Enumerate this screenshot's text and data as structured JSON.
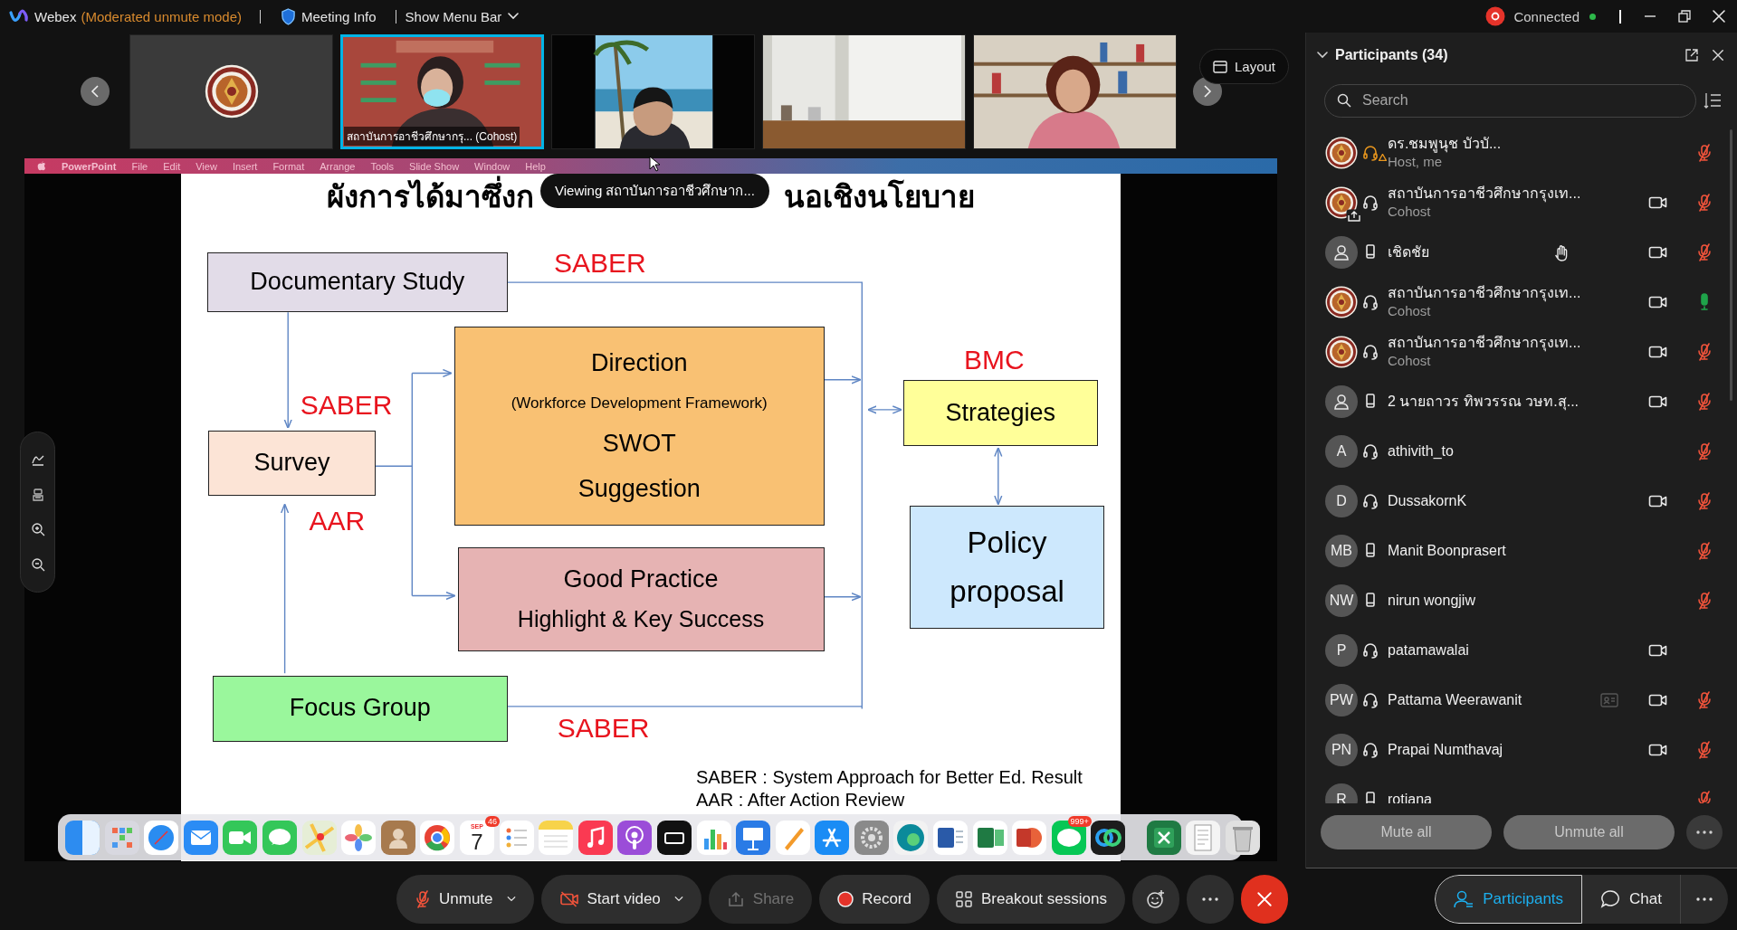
{
  "top_bar": {
    "app_name": "Webex",
    "mode": "(Moderated unmute mode)",
    "meeting_info": "Meeting Info",
    "menu_bar_toggle": "Show Menu Bar",
    "connection": "Connected"
  },
  "video_strip": {
    "tiles": [
      {
        "kind": "logo",
        "selected": false
      },
      {
        "kind": "picture",
        "label": "สถาบันการอาชีวศึกษากรุ... (Cohost)",
        "selected": true
      },
      {
        "kind": "picture",
        "selected": false
      },
      {
        "kind": "picture",
        "selected": false
      },
      {
        "kind": "picture",
        "selected": false
      }
    ],
    "layout_button": "Layout"
  },
  "shared_screen": {
    "menu_bar": [
      "PowerPoint",
      "File",
      "Edit",
      "View",
      "Insert",
      "Format",
      "Arrange",
      "Tools",
      "Slide Show",
      "Window",
      "Help"
    ],
    "viewing_tooltip": "Viewing สถาบันการอาชีวศึกษาก...",
    "slide": {
      "title_parts": [
        "ผังการได้มาซึ่งก",
        "นอเชิงนโยบาย"
      ],
      "boxes": [
        {
          "color": "#e2dce8",
          "lines": [
            {
              "text": "Documentary Study",
              "kind": "main"
            }
          ]
        },
        {
          "color": "#fce4d6",
          "lines": [
            {
              "text": "Survey",
              "kind": "main"
            }
          ]
        },
        {
          "color": "#f9c173",
          "lines": [
            {
              "text": "Direction",
              "kind": "main"
            },
            {
              "text": "(Workforce Development Framework)",
              "kind": "note"
            },
            {
              "text": "SWOT",
              "kind": "main"
            },
            {
              "text": "Suggestion",
              "kind": "main"
            }
          ]
        },
        {
          "color": "#e6b3b3",
          "lines": [
            {
              "text": "Good Practice",
              "kind": "main"
            },
            {
              "text": "Highlight & Key Success",
              "kind": "sub"
            }
          ]
        },
        {
          "color": "#9af79c",
          "lines": [
            {
              "text": "Focus Group",
              "kind": "main"
            }
          ]
        },
        {
          "color": "#ffff99",
          "lines": [
            {
              "text": "Strategies",
              "kind": "main"
            }
          ]
        },
        {
          "color": "#cde8fd",
          "lines": [
            {
              "text": "Policy",
              "kind": "big"
            },
            {
              "text": "proposal",
              "kind": "big"
            }
          ]
        }
      ],
      "labels": [
        "SABER",
        "SABER",
        "AAR",
        "BMC",
        "SABER"
      ],
      "legend": [
        "SABER : System Approach for Better Ed. Result",
        "AAR : After Action Review"
      ]
    }
  },
  "dock": {
    "calendar": {
      "month": "SEP",
      "day": "7",
      "badge": "46"
    },
    "messenger_badge": "999+"
  },
  "participants": {
    "title": "Participants (34)",
    "search_placeholder": "Search",
    "rows": [
      {
        "kind": "logo",
        "phone": false,
        "audio_warning": true,
        "name": "ดร.ชมพูนุช บัวบั...",
        "role": "Host, me",
        "sharing": false,
        "hand_raised": false,
        "contact_card": false,
        "video": false,
        "muted": true,
        "mic_on": false
      },
      {
        "kind": "logo",
        "phone": false,
        "audio_warning": false,
        "name": "สถาบันการอาชีวศึกษากรุงเท...",
        "role": "Cohost",
        "sharing": true,
        "hand_raised": false,
        "contact_card": false,
        "video": true,
        "muted": true,
        "mic_on": false
      },
      {
        "kind": "person",
        "phone": true,
        "audio_warning": false,
        "name": "เชิดชัย",
        "sharing": false,
        "hand_raised": true,
        "contact_card": false,
        "video": true,
        "muted": true,
        "mic_on": false
      },
      {
        "kind": "logo",
        "phone": false,
        "audio_warning": false,
        "name": "สถาบันการอาชีวศึกษากรุงเท...",
        "role": "Cohost",
        "sharing": false,
        "hand_raised": false,
        "contact_card": false,
        "video": true,
        "muted": false,
        "mic_on": true
      },
      {
        "kind": "logo",
        "phone": false,
        "audio_warning": false,
        "name": "สถาบันการอาชีวศึกษากรุงเท...",
        "role": "Cohost",
        "sharing": false,
        "hand_raised": false,
        "contact_card": false,
        "video": true,
        "muted": true,
        "mic_on": false
      },
      {
        "kind": "person",
        "phone": true,
        "audio_warning": false,
        "name": "2 นายถาวร ทิพวรรณ วษท.สุ...",
        "sharing": false,
        "hand_raised": false,
        "contact_card": false,
        "video": true,
        "muted": true,
        "mic_on": false
      },
      {
        "kind": "initials",
        "initials": "A",
        "phone": false,
        "audio_warning": false,
        "name": "athivith_to",
        "sharing": false,
        "hand_raised": false,
        "contact_card": false,
        "video": false,
        "muted": true,
        "mic_on": false
      },
      {
        "kind": "initials",
        "initials": "D",
        "phone": false,
        "audio_warning": false,
        "name": "DussakornK",
        "sharing": false,
        "hand_raised": false,
        "contact_card": false,
        "video": true,
        "muted": true,
        "mic_on": false
      },
      {
        "kind": "initials",
        "initials": "MB",
        "phone": true,
        "audio_warning": false,
        "name": "Manit Boonprasert",
        "sharing": false,
        "hand_raised": false,
        "contact_card": false,
        "video": false,
        "muted": true,
        "mic_on": false
      },
      {
        "kind": "initials",
        "initials": "NW",
        "phone": true,
        "audio_warning": false,
        "name": "nirun wongjiw",
        "sharing": false,
        "hand_raised": false,
        "contact_card": false,
        "video": false,
        "muted": true,
        "mic_on": false
      },
      {
        "kind": "initials",
        "initials": "P",
        "phone": false,
        "audio_warning": false,
        "name": "patamawalai",
        "sharing": false,
        "hand_raised": false,
        "contact_card": false,
        "video": true,
        "muted": false,
        "mic_on": false
      },
      {
        "kind": "initials",
        "initials": "PW",
        "phone": false,
        "audio_warning": false,
        "name": "Pattama Weerawanit",
        "sharing": false,
        "hand_raised": false,
        "contact_card": true,
        "video": true,
        "muted": true,
        "mic_on": false
      },
      {
        "kind": "initials",
        "initials": "PN",
        "phone": false,
        "audio_warning": false,
        "name": "Prapai Numthavaj",
        "sharing": false,
        "hand_raised": false,
        "contact_card": false,
        "video": true,
        "muted": true,
        "mic_on": false
      },
      {
        "kind": "initials",
        "initials": "R",
        "phone": true,
        "audio_warning": false,
        "name": "rotiana",
        "sharing": false,
        "hand_raised": false,
        "contact_card": false,
        "video": false,
        "muted": true,
        "mic_on": false
      }
    ],
    "footer_buttons": [
      "Mute all",
      "Unmute all"
    ]
  },
  "toolbar": {
    "controls": [
      {
        "kind": "unmute",
        "label": "Unmute",
        "menu": true,
        "disabled": false
      },
      {
        "kind": "video",
        "label": "Start video",
        "menu": true,
        "disabled": false
      },
      {
        "kind": "share",
        "label": "Share",
        "menu": false,
        "disabled": true
      },
      {
        "kind": "record",
        "label": "Record",
        "menu": false,
        "disabled": false
      },
      {
        "kind": "breakout",
        "label": "Breakout sessions",
        "menu": false,
        "disabled": false
      },
      {
        "kind": "reactions",
        "menu": false,
        "disabled": false
      },
      {
        "kind": "more",
        "menu": false,
        "disabled": false
      },
      {
        "kind": "leave",
        "menu": false,
        "disabled": false
      }
    ],
    "tabs": [
      {
        "label": "Participants",
        "selected": true
      },
      {
        "label": "Chat",
        "selected": false
      }
    ]
  }
}
